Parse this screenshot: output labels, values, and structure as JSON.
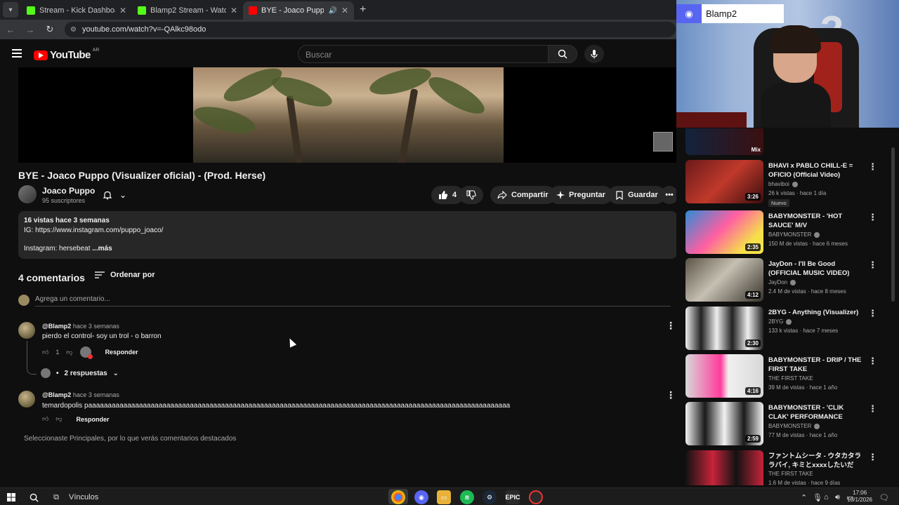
{
  "browser": {
    "tabs": [
      {
        "title": "Stream - Kick Dashboard",
        "active": false
      },
      {
        "title": "Blamp2 Stream - Watch Live on",
        "active": false
      },
      {
        "title": "BYE - Joaco Puppo (Visualiz",
        "active": true
      }
    ],
    "url": "youtube.com/watch?v=-QAlkc98odo"
  },
  "yt": {
    "logo_text": "YouTube",
    "country": "AR",
    "search_placeholder": "Buscar"
  },
  "video": {
    "title": "BYE - Joaco Puppo (Visualizer oficial) - (Prod. Herse)",
    "channel": "Joaco Puppo",
    "subscribers": "95 suscriptores",
    "likes": "4",
    "share_label": "Compartir",
    "ask_label": "Preguntar",
    "save_label": "Guardar",
    "description": {
      "meta": "16 vistas  hace 3 semanas",
      "line1": "IG: https://www.instagram.com/puppo_joaco/",
      "line2": "Instagram: hersebeat",
      "more": "...más"
    }
  },
  "comments": {
    "count_label": "4 comentarios",
    "sort_label": "Ordenar por",
    "add_placeholder": "Agrega un comentario...",
    "items": [
      {
        "user": "@Blamp2",
        "time": "hace 3 semanas",
        "text": "pierdo el control- soy un trol - o barron",
        "likes": "1",
        "reply_label": "Responder",
        "replies_label": "2 respuestas"
      },
      {
        "user": "@Blamp2",
        "time": "hace 3 semanas",
        "text": "temardopolis paaaaaaaaaaaaaaaaaaaaaaaaaaaaaaaaaaaaaaaaaaaaaaaaaaaaaaaaaaaaaaaaaaaaaaaaaaaaaaaaaaaaaaaaaaaaaaaaaaaaaaaaaaaa",
        "reply_label": "Responder"
      }
    ],
    "note": "Seleccionaste Principales, por lo que verás comentarios destacados"
  },
  "overlay": {
    "discord_name": "Blamp2"
  },
  "suggestions": {
    "mix_label": "Mix",
    "items": [
      {
        "title": "BHAVI x PABLO CHILL-E = OFICIO (Official Video)",
        "channel": "bhaviboi",
        "stats": "26 k vistas · hace 1 día",
        "duration": "3:26",
        "badge": "Nuevo"
      },
      {
        "title": "BABYMONSTER - 'HOT SAUCE' M/V",
        "channel": "BABYMONSTER",
        "stats": "150 M de vistas · hace 6 meses",
        "duration": "2:35"
      },
      {
        "title": "JayDon - I'll Be Good (OFFICIAL MUSIC VIDEO)",
        "channel": "JayDon",
        "stats": "2.4 M de vistas · hace 8 meses",
        "duration": "4:12"
      },
      {
        "title": "2BYG - Anything (Visualizer)",
        "channel": "2BYG",
        "stats": "133 k vistas · hace 7 meses",
        "duration": "2:30"
      },
      {
        "title": "BABYMONSTER - DRIP / THE FIRST TAKE",
        "channel": "THE FIRST TAKE",
        "stats": "39 M de vistas · hace 1 año",
        "duration": "4:16"
      },
      {
        "title": "BABYMONSTER - 'CLIK CLAK' PERFORMANCE VIDEO",
        "channel": "BABYMONSTER",
        "stats": "77 M de vistas · hace 1 año",
        "duration": "2:59"
      },
      {
        "title": "ファントムシータ - ウタカタララバイ, キミとxxxxしたいだけ…",
        "channel": "THE FIRST TAKE",
        "stats": "1.6 M de vistas · hace 9 días",
        "duration": ""
      }
    ]
  },
  "taskbar": {
    "links_label": "Vínculos",
    "time": "17:06",
    "date": "10/1/2026"
  }
}
